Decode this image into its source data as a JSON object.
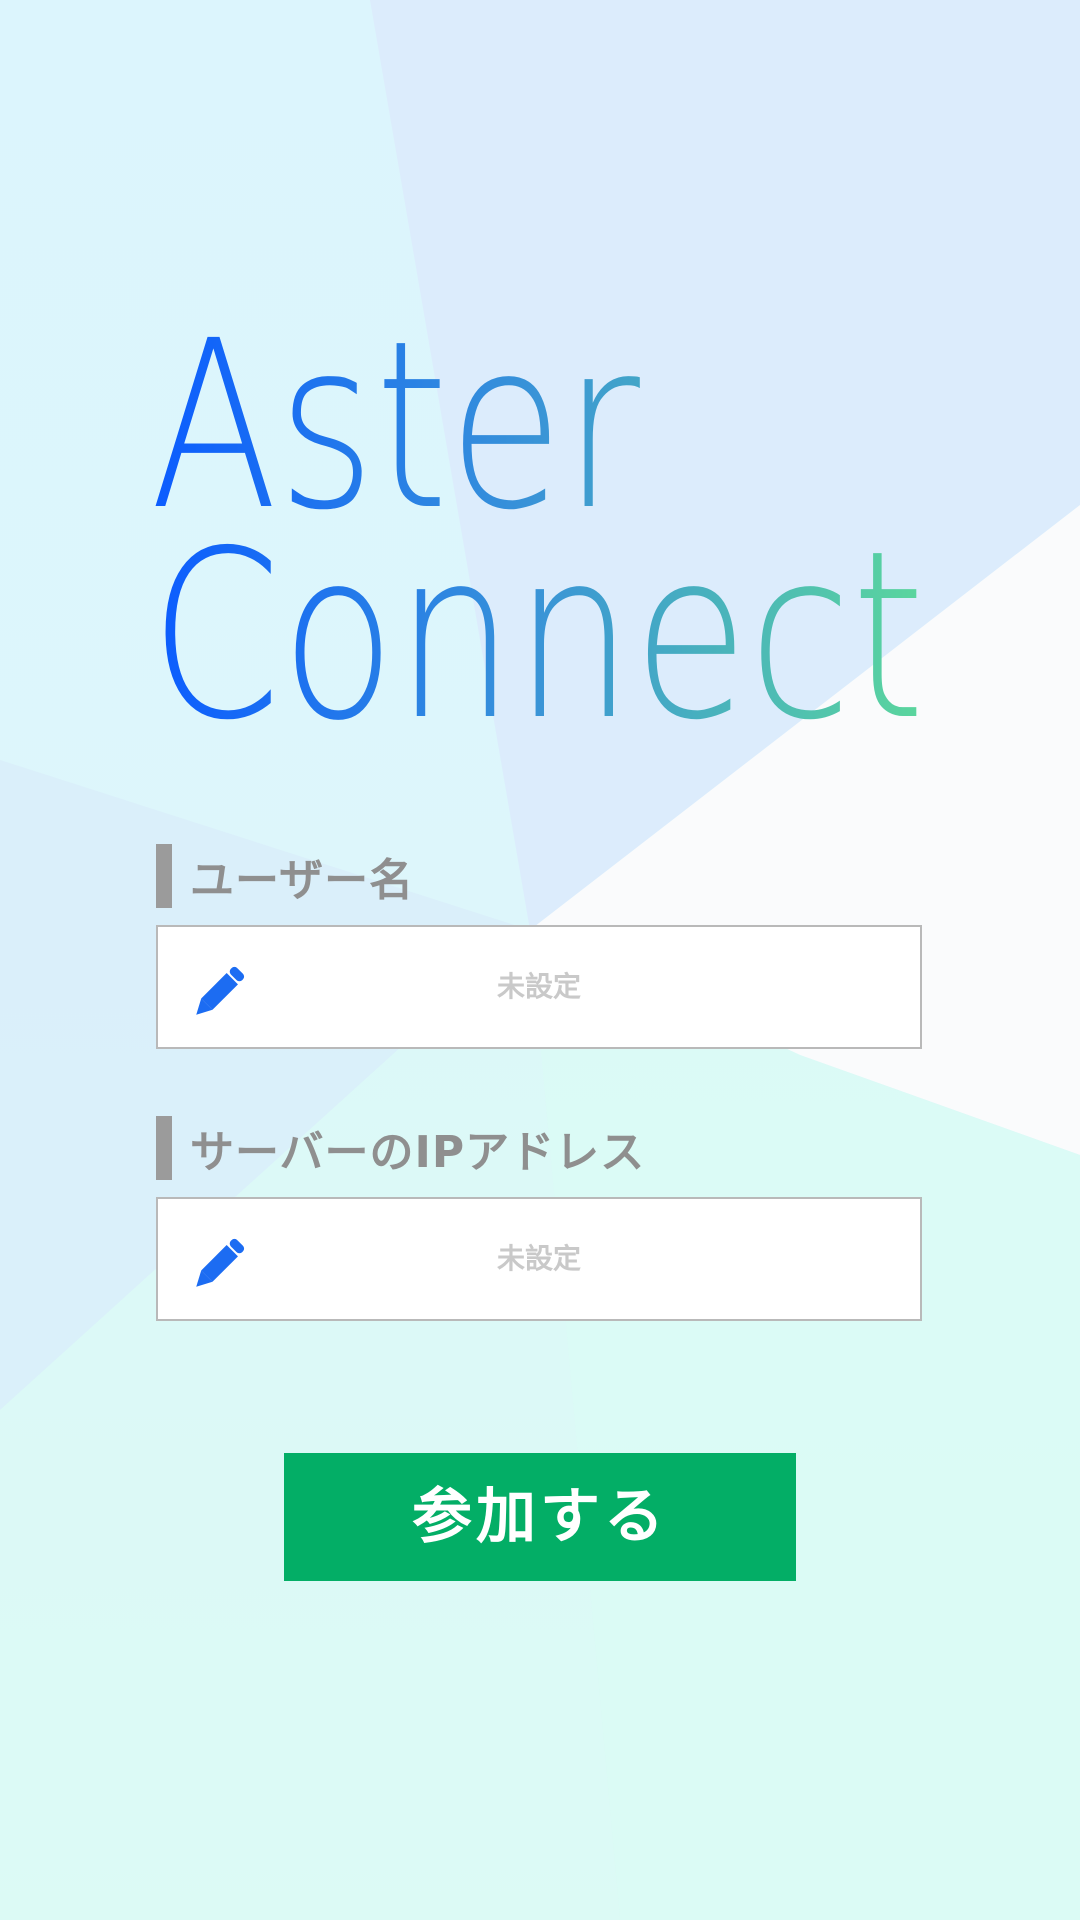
{
  "app": {
    "title_line1": "Aster",
    "title_line2": "Connect"
  },
  "colors": {
    "logo_gradient_start": "#0b5cff",
    "logo_gradient_end": "#5cd99a",
    "join_button": "#03ae66",
    "pencil": "#1c6cf2",
    "label_gray": "#8f8f8f"
  },
  "form": {
    "username": {
      "label": "ユーザー名",
      "placeholder": "未設定",
      "value": "",
      "icon": "pencil-icon"
    },
    "server_ip": {
      "label": "サーバーのIPアドレス",
      "placeholder": "未設定",
      "value": "",
      "icon": "pencil-icon"
    }
  },
  "actions": {
    "join_label": "参加する"
  }
}
